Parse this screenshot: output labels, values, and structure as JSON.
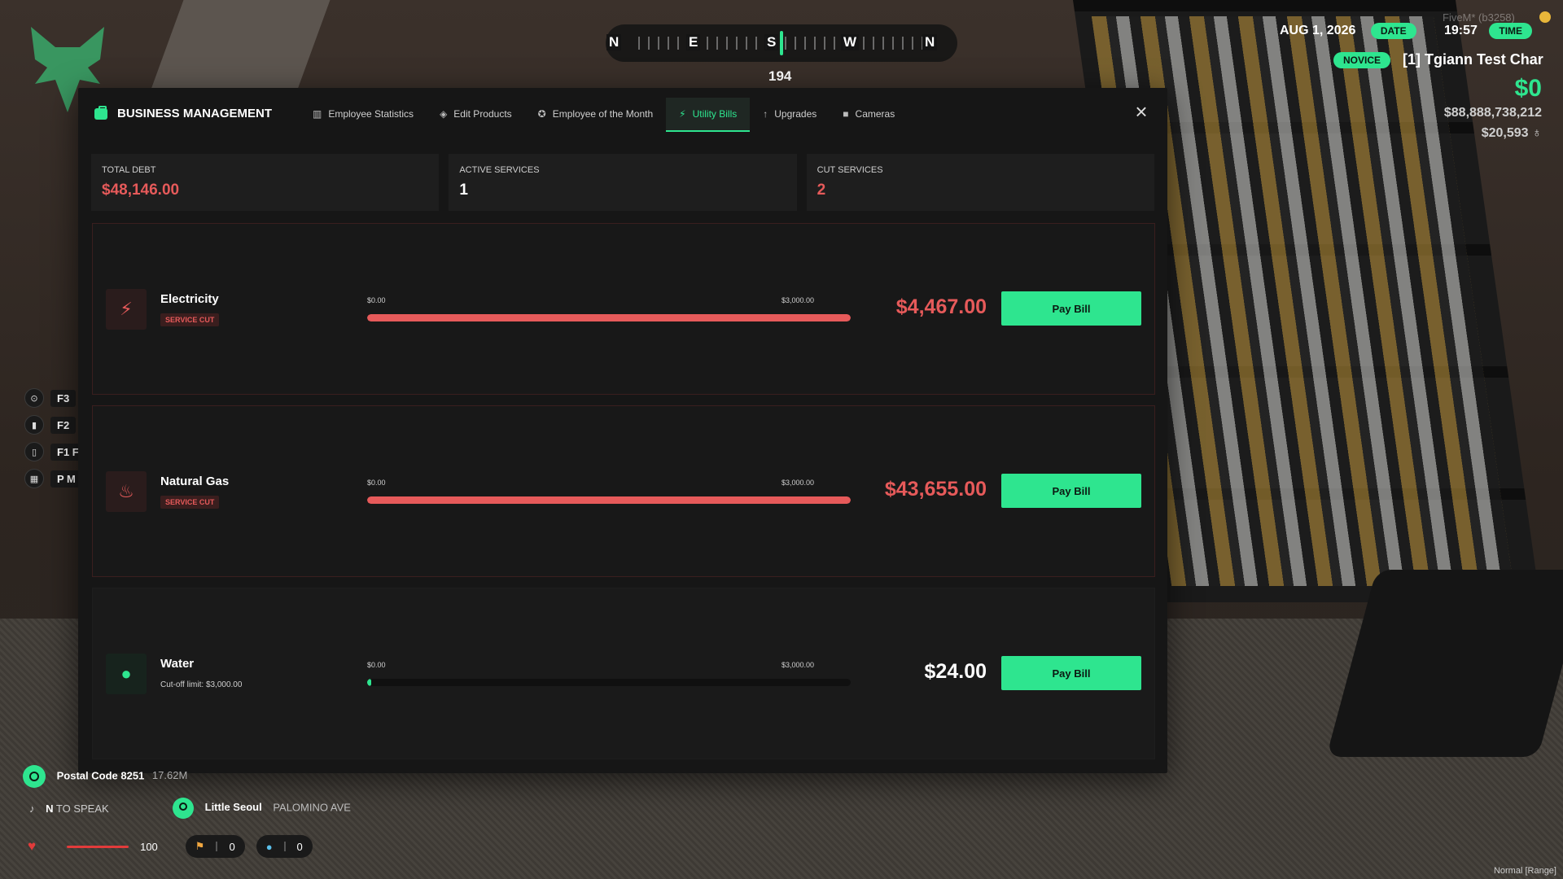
{
  "hud": {
    "compass": {
      "n1": "N",
      "e": "E",
      "s": "S",
      "w": "W",
      "n2": "N",
      "heading": "194"
    },
    "fivem": "FiveM* (b3258)",
    "date": "AUG 1, 2026",
    "date_label": "DATE",
    "time": "19:57",
    "time_label": "TIME",
    "rank": "NOVICE",
    "character": "[1] Tgiann Test Char",
    "cash": "$0",
    "bank": "$88,888,738,212",
    "dirty": "$20,593",
    "keys": [
      {
        "icon": "⊙",
        "key": "F3"
      },
      {
        "icon": "▮",
        "key": "F2"
      },
      {
        "icon": "▯",
        "key": "F1 F"
      },
      {
        "icon": "▦",
        "key": "P M"
      }
    ],
    "postal": "Postal Code 8251",
    "postal_distance": "17.62M",
    "speak_key": "N",
    "speak_text": "TO SPEAK",
    "zone": "Little Seoul",
    "street": "PALOMINO AVE",
    "health": "100",
    "stamina": "0",
    "thirst": "0",
    "range": "Normal [Range]"
  },
  "modal": {
    "title": "BUSINESS MANAGEMENT",
    "tabs": [
      {
        "icon": "chart-icon",
        "label": "Employee Statistics"
      },
      {
        "icon": "tag-icon",
        "label": "Edit Products"
      },
      {
        "icon": "award-icon",
        "label": "Employee of the Month"
      },
      {
        "icon": "bolt-icon",
        "label": "Utility Bills"
      },
      {
        "icon": "arrow-up-icon",
        "label": "Upgrades"
      },
      {
        "icon": "camera-icon",
        "label": "Cameras"
      }
    ],
    "active_tab": "Utility Bills",
    "stats": {
      "total_debt_label": "TOTAL DEBT",
      "total_debt": "$48,146.00",
      "active_label": "ACTIVE SERVICES",
      "active": "1",
      "cut_label": "CUT SERVICES",
      "cut": "2"
    },
    "bills": [
      {
        "name": "Electricity",
        "badge": "SERVICE CUT",
        "min": "$0.00",
        "max": "$3,000.00",
        "amount": "$4,467.00",
        "fill_percent": 100,
        "button": "Pay Bill"
      },
      {
        "name": "Natural Gas",
        "badge": "SERVICE CUT",
        "min": "$0.00",
        "max": "$3,000.00",
        "amount": "$43,655.00",
        "fill_percent": 100,
        "button": "Pay Bill"
      },
      {
        "name": "Water",
        "sub": "Cut-off limit: $3,000.00",
        "min": "$0.00",
        "max": "$3,000.00",
        "amount": "$24.00",
        "fill_percent": 0.8,
        "button": "Pay Bill"
      }
    ]
  },
  "colors": {
    "accent": "#2ee58f",
    "danger": "#e65a5a",
    "panel": "#161616"
  }
}
